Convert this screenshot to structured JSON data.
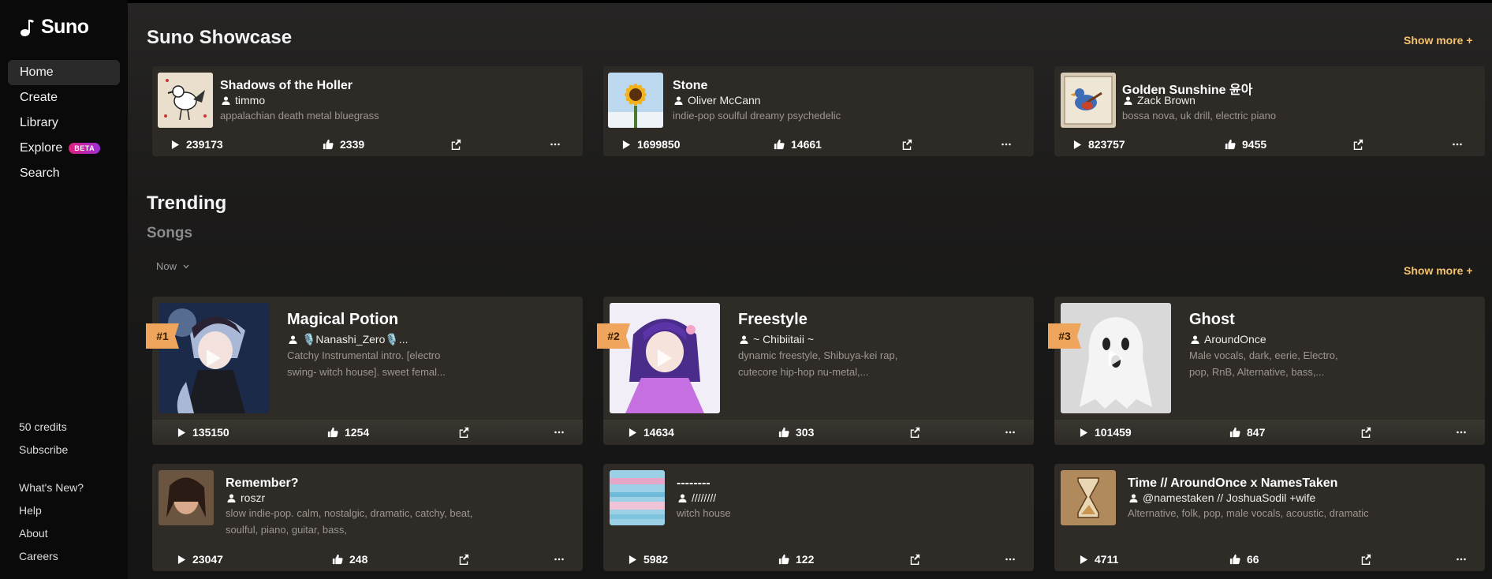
{
  "app": {
    "name": "Suno"
  },
  "sidebar": {
    "nav": [
      {
        "label": "Home",
        "active": true
      },
      {
        "label": "Create"
      },
      {
        "label": "Library"
      },
      {
        "label": "Explore",
        "badge": "BETA"
      },
      {
        "label": "Search"
      }
    ],
    "credits": "50 credits",
    "subscribe": "Subscribe",
    "links": [
      "What's New?",
      "Help",
      "About",
      "Careers"
    ]
  },
  "showcase": {
    "title": "Suno Showcase",
    "show_more": "Show more +",
    "cards": [
      {
        "title": "Shadows of the Holler",
        "author": "timmo",
        "tags": "appalachian death metal bluegrass",
        "plays": "239173",
        "likes": "2339"
      },
      {
        "title": "Stone",
        "author": "Oliver McCann",
        "tags": "indie-pop soulful dreamy psychedelic",
        "plays": "1699850",
        "likes": "14661"
      },
      {
        "title": "Golden Sunshine 윤아",
        "author": "Zack Brown",
        "tags": "bossa nova, uk drill, electric piano",
        "plays": "823757",
        "likes": "9455"
      }
    ]
  },
  "trending": {
    "title": "Trending",
    "subtitle": "Songs",
    "filter": "Now",
    "show_more": "Show more +",
    "top": [
      {
        "rank": "#1",
        "title": "Magical Potion",
        "author": "🎙️Nanashi_Zero🎙️...",
        "tags_line1": "Catchy Instrumental intro. [electro",
        "tags_line2": "swing- witch house]. sweet femal...",
        "plays": "135150",
        "likes": "1254"
      },
      {
        "rank": "#2",
        "title": "Freestyle",
        "author": "~ Chibiitaii ~",
        "tags_line1": "dynamic freestyle, Shibuya-kei rap,",
        "tags_line2": "cutecore hip-hop nu-metal,...",
        "plays": "14634",
        "likes": "303"
      },
      {
        "rank": "#3",
        "title": "Ghost",
        "author": "AroundOnce",
        "tags_line1": "Male vocals, dark, eerie, Electro,",
        "tags_line2": "pop, RnB, Alternative, bass,...",
        "plays": "101459",
        "likes": "847"
      }
    ],
    "more": [
      {
        "title": "Remember?",
        "author": "roszr",
        "tags_line1": "slow indie-pop. calm, nostalgic, dramatic, catchy, beat,",
        "tags_line2": "soulful, piano, guitar, bass,",
        "plays": "23047",
        "likes": "248"
      },
      {
        "title": "--------",
        "author": "////////",
        "tags_line1": "witch house",
        "tags_line2": "",
        "plays": "5982",
        "likes": "122"
      },
      {
        "title": "Time // AroundOnce x NamesTaken",
        "author": "@namestaken // JoshuaSodil +wife",
        "tags_line1": "Alternative, folk, pop, male vocals, acoustic, dramatic",
        "tags_line2": "",
        "plays": "4711",
        "likes": "66"
      }
    ]
  },
  "colors": {
    "accent": "#f6c36b",
    "rank_badge": "#f0a55c",
    "card_bg": "#2e2b27"
  }
}
